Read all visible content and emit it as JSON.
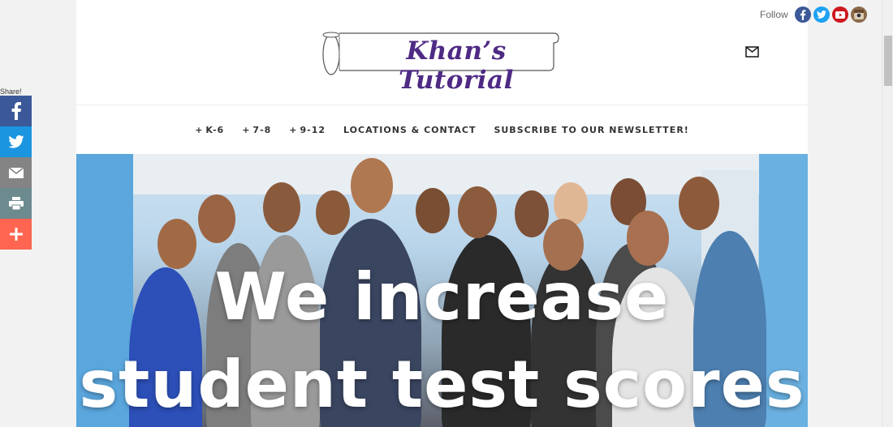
{
  "header": {
    "logo_text": "Khan’s Tutorial"
  },
  "follow": {
    "label": "Follow",
    "icons": [
      "facebook-icon",
      "twitter-icon",
      "youtube-icon",
      "instagram-icon"
    ],
    "colors": {
      "facebook": "#3b5998",
      "twitter": "#1da1f2",
      "youtube": "#cc181e",
      "instagram": "#8a6a4a"
    }
  },
  "share": {
    "label": "Share!",
    "colors": {
      "facebook": "#3b5998",
      "twitter": "#1b95e0",
      "email": "#848484",
      "print": "#6d8a8e",
      "more": "#ff6550"
    }
  },
  "nav": {
    "items": [
      {
        "plus": "+",
        "label": "K-6"
      },
      {
        "plus": "+",
        "label": "7-8"
      },
      {
        "plus": "+",
        "label": "9-12"
      },
      {
        "plus": "",
        "label": "LOCATIONS & CONTACT"
      },
      {
        "plus": "",
        "label": "SUBSCRIBE TO OUR NEWSLETTER!"
      }
    ]
  },
  "hero": {
    "line1": "We increase",
    "line2": "student test scores"
  }
}
